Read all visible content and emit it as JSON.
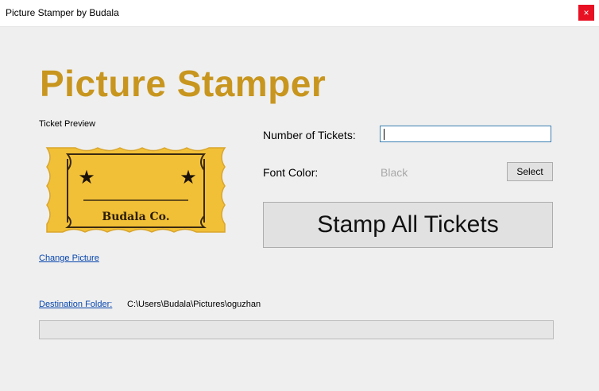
{
  "window": {
    "title": "Picture Stamper by Budala",
    "close_glyph": "×"
  },
  "heading": "Picture Stamper",
  "preview": {
    "label": "Ticket Preview",
    "ticket_text": "Budala Co.",
    "ticket_color": "#f2c037",
    "change_picture_label": "Change Picture"
  },
  "form": {
    "tickets_label": "Number of Tickets:",
    "tickets_value": "",
    "font_color_label": "Font Color:",
    "font_color_value": "Black",
    "select_label": "Select",
    "stamp_label": "Stamp All Tickets"
  },
  "destination": {
    "label": "Destination Folder:",
    "path": "C:\\Users\\Budala\\Pictures\\oguzhan"
  },
  "progress": {
    "value": 0
  },
  "colors": {
    "accent": "#c8961e",
    "close": "#e81123",
    "link": "#0645ad"
  }
}
